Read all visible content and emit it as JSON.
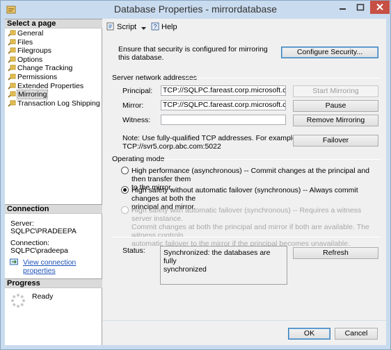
{
  "window": {
    "title": "Database Properties - mirrordatabase"
  },
  "left_panel": {
    "select_page_header": "Select a page",
    "pages": [
      {
        "label": "General"
      },
      {
        "label": "Files"
      },
      {
        "label": "Filegroups"
      },
      {
        "label": "Options"
      },
      {
        "label": "Change Tracking"
      },
      {
        "label": "Permissions"
      },
      {
        "label": "Extended Properties"
      },
      {
        "label": "Mirroring",
        "selected": true
      },
      {
        "label": "Transaction Log Shipping"
      }
    ],
    "connection_header": "Connection",
    "server_label": "Server:",
    "server_value": "SQLPC\\PRADEEPA",
    "connection_label": "Connection:",
    "connection_value": "SQLPC\\pradeepa",
    "view_connection_link": "View connection properties",
    "progress_header": "Progress",
    "progress_status": "Ready"
  },
  "toolbar": {
    "script_label": "Script",
    "help_label": "Help"
  },
  "security": {
    "text": "Ensure that security is configured for mirroring this database.",
    "configure_button": "Configure Security..."
  },
  "server_network": {
    "group_label": "Server network addresses",
    "principal_label": "Principal:",
    "principal_value": "TCP://SQLPC.fareast.corp.microsoft.c",
    "mirror_label": "Mirror:",
    "mirror_value": "TCP://SQLPC.fareast.corp.microsoft.c",
    "witness_label": "Witness:",
    "witness_value": "",
    "start_mirroring_button": "Start Mirroring",
    "pause_button": "Pause",
    "remove_mirroring_button": "Remove Mirroring",
    "failover_button": "Failover",
    "note": "Note: Use fully-qualified TCP addresses. For example:",
    "note_example": "TCP://svr5.corp.abc.com:5022"
  },
  "operating_mode": {
    "group_label": "Operating mode",
    "options": [
      {
        "line1": "High performance (asynchronous) -- Commit changes at the principal and then transfer them",
        "line2": "to the mirror.",
        "checked": false,
        "disabled": false
      },
      {
        "line1": "High safety without automatic failover (synchronous) -- Always commit changes at both the",
        "line2": "principal and mirror.",
        "checked": true,
        "disabled": false
      },
      {
        "line1": "High safety with automatic failover (synchronous) -- Requires a witness server instance.",
        "line2": "Commit changes at both the principal and mirror if both are available. The witness controls",
        "line3": "automatic failover to the mirror if the principal becomes unavailable.",
        "checked": false,
        "disabled": true
      }
    ]
  },
  "status": {
    "label": "Status:",
    "line1": "Synchronized: the databases are fully",
    "line2": "synchronized",
    "refresh_button": "Refresh"
  },
  "footer": {
    "ok_button": "OK",
    "cancel_button": "Cancel"
  },
  "colors": {
    "title_bar": "#c9dbee",
    "close_button": "#c74f44",
    "link": "#1a50b8",
    "default_button_border": "#3c7fb1"
  },
  "icons": [
    "app-icon",
    "minimize-icon",
    "maximize-icon",
    "close-icon",
    "page-icon",
    "script-icon",
    "dropdown-arrow-icon",
    "help-icon",
    "connection-link-icon",
    "progress-spinner-icon"
  ]
}
